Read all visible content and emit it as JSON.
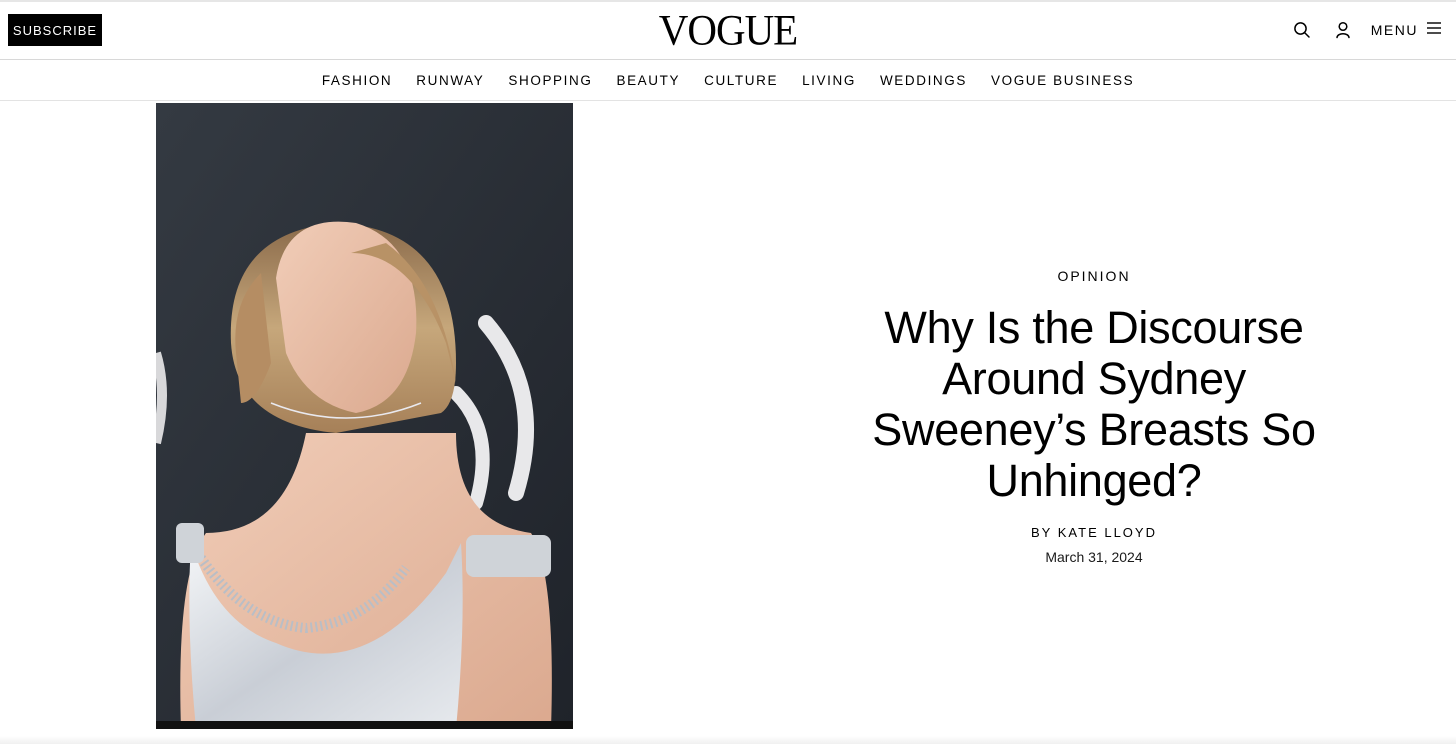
{
  "header": {
    "subscribe_label": "SUBSCRIBE",
    "logo": "VOGUE",
    "menu_label": "MENU",
    "icons": [
      "search-icon",
      "account-icon",
      "hamburger-icon"
    ]
  },
  "nav": {
    "items": [
      {
        "label": "FASHION"
      },
      {
        "label": "RUNWAY"
      },
      {
        "label": "SHOPPING"
      },
      {
        "label": "BEAUTY"
      },
      {
        "label": "CULTURE"
      },
      {
        "label": "LIVING"
      },
      {
        "label": "WEDDINGS"
      },
      {
        "label": "VOGUE BUSINESS"
      }
    ]
  },
  "article": {
    "rubric": "OPINION",
    "headline": "Why Is the Discourse Around Sydney Sweeney’s Breasts So Unhinged?",
    "byline_prefix": "BY",
    "author": "KATE LLOYD",
    "date": "March 31, 2024"
  },
  "colors": {
    "text": "#000000",
    "subscribe_bg": "#000000",
    "subscribe_text": "#ffffff",
    "hero_backdrop": "#2a2f36"
  }
}
